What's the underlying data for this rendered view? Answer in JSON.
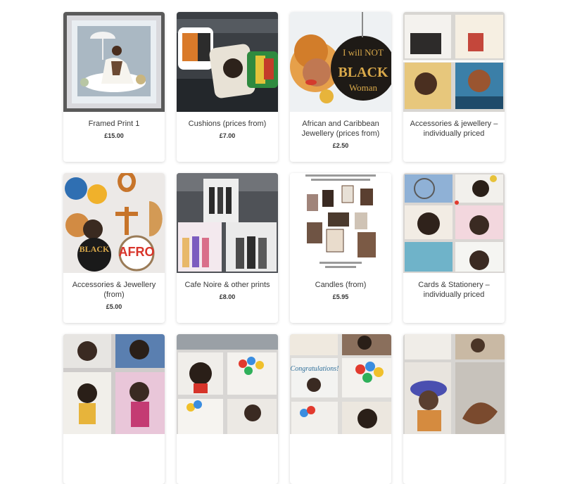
{
  "products": [
    {
      "title": "Framed Print 1",
      "price": "£15.00",
      "image": "framed-print"
    },
    {
      "title": "Cushions (prices from)",
      "price": "£7.00",
      "image": "cushions"
    },
    {
      "title": "African and Caribbean Jewellery (prices from)",
      "price": "£2.50",
      "image": "jewellery-earrings"
    },
    {
      "title": "Accessories & jewellery – individually priced",
      "price": "",
      "image": "card-display"
    },
    {
      "title": "Accessories & Jewellery (from)",
      "price": "£5.00",
      "image": "accessories-earrings"
    },
    {
      "title": "Cafe Noire & other prints",
      "price": "£8.00",
      "image": "prints"
    },
    {
      "title": "Candles (from)",
      "price": "£5.95",
      "image": "candles-flyer"
    },
    {
      "title": "Cards & Stationery – individually priced",
      "price": "",
      "image": "birthday-cards"
    },
    {
      "title": "",
      "price": "",
      "image": "greeting-cards"
    },
    {
      "title": "",
      "price": "",
      "image": "birthday-cards-balloons"
    },
    {
      "title": "",
      "price": "",
      "image": "congratulations-cards"
    },
    {
      "title": "",
      "price": "",
      "image": "hat-cards"
    }
  ],
  "colors": {
    "accent": "#e23a2e",
    "card_shadow": "rgba(0,0,0,0.16)",
    "text": "#333333"
  }
}
